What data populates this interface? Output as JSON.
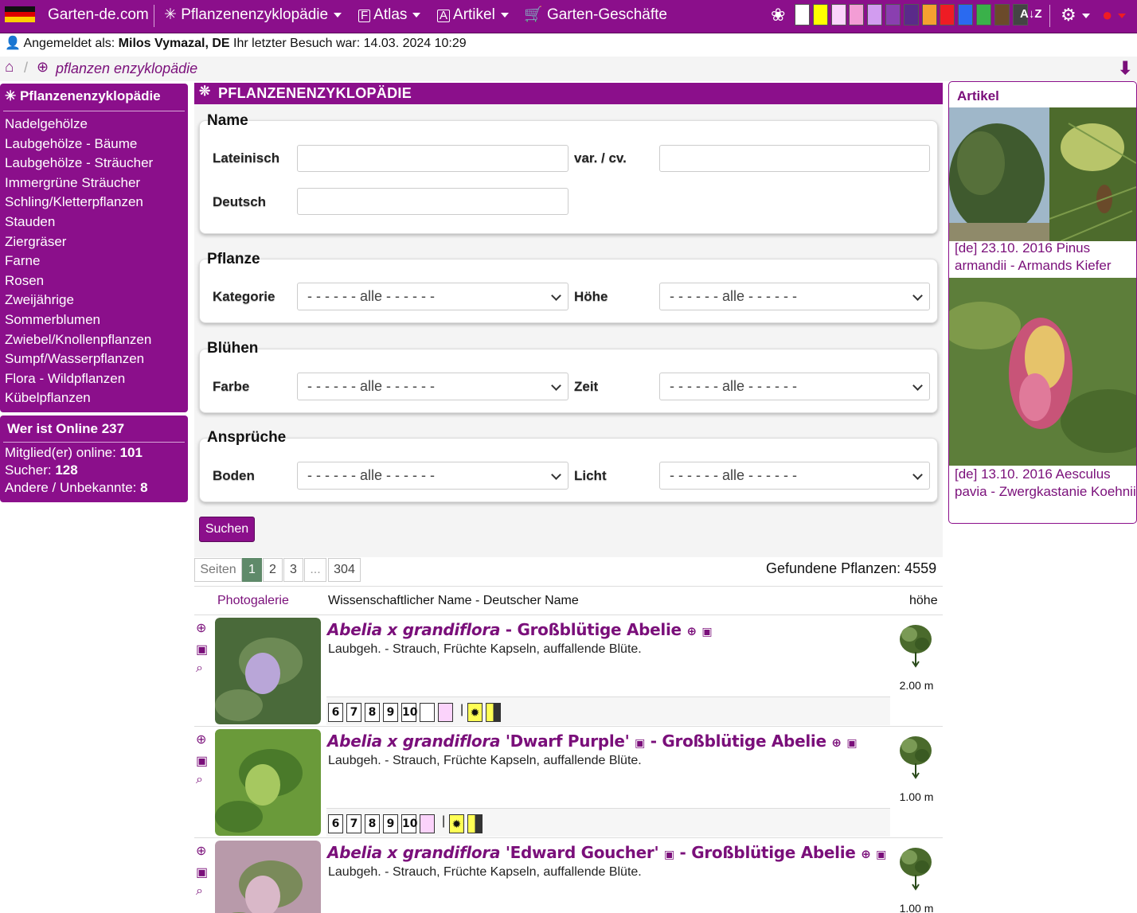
{
  "nav": {
    "site": "Garten-de.com",
    "items": [
      "Pflanzenenzyklopädie",
      "Atlas",
      "Artikel",
      "Garten-Geschäfte"
    ],
    "swatches": [
      "#ffffff",
      "#ffff00",
      "#fbd3fb",
      "#f39dd5",
      "#d29cf0",
      "#8a3fb0",
      "#5a2a8a",
      "#f5a030",
      "#ee1c24",
      "#2a6af0",
      "#3ab14a",
      "#6b4a2a",
      "#444444"
    ]
  },
  "info": {
    "prefix": "Angemeldet als:",
    "user": "Milos Vymazal, DE",
    "last": "Ihr letzter Besuch war: 14.03. 2024 10:29"
  },
  "breadcrumb": {
    "page": "pflanzen enzyklopädie"
  },
  "sidebar": {
    "title": "Pflanzenenzyklopädie",
    "items": [
      "Nadelgehölze",
      "Laubgehölze - Bäume",
      "Laubgehölze - Sträucher",
      "Immergrüne Sträucher",
      "Schling/Kletterpflanzen",
      "Stauden",
      "Ziergräser",
      "Farne",
      "Rosen",
      "Zweijährige",
      "Sommerblumen",
      "Zwiebel/Knollenpflanzen",
      "Sumpf/Wasserpflanzen",
      "Flora - Wildpflanzen",
      "Kübelpflanzen"
    ]
  },
  "online": {
    "title": "Wer ist Online 237",
    "members_label": "Mitglied(er) online:",
    "members": "101",
    "search_label": "Sucher:",
    "search": "128",
    "other_label": "Andere / Unbekannte:",
    "other": "8"
  },
  "main": {
    "title": "PFLANZENENZYKLOPÄDIE",
    "name_legend": "Name",
    "latin": "Lateinisch",
    "var": "var. / cv.",
    "german": "Deutsch",
    "plant_legend": "Pflanze",
    "category": "Kategorie",
    "height": "Höhe",
    "bloom_legend": "Blühen",
    "color": "Farbe",
    "time": "Zeit",
    "req_legend": "Ansprüche",
    "soil": "Boden",
    "light": "Licht",
    "all_option": "- - - - - - alle - - - - - -",
    "search_btn": "Suchen"
  },
  "pagination": {
    "label": "Seiten",
    "pages": [
      "1",
      "2",
      "3",
      "...",
      "304"
    ],
    "found": "Gefundene Pflanzen: 4559"
  },
  "table": {
    "col1": "Photogalerie",
    "col2": "Wissenschaftlicher Name - Deutscher Name",
    "col3": "höhe"
  },
  "rows": [
    {
      "latin": "Abelia x grandiflora",
      "cv": "",
      "german": "Großblütige Abelie",
      "desc": "Laubgeh. - Strauch, Früchte Kapseln, auffallende Blüte.",
      "height": "2.00 m",
      "months": [
        "6",
        "7",
        "8",
        "9",
        "10"
      ]
    },
    {
      "latin": "Abelia x grandiflora",
      "cv": "'Dwarf Purple'",
      "german": "Großblütige Abelie",
      "desc": "Laubgeh. - Strauch, Früchte Kapseln, auffallende Blüte.",
      "height": "1.00 m",
      "months": [
        "6",
        "7",
        "8",
        "9",
        "10"
      ]
    },
    {
      "latin": "Abelia x grandiflora",
      "cv": "'Edward Goucher'",
      "german": "Großblütige Abelie",
      "desc": "Laubgeh. - Strauch, Früchte Kapseln, auffallende Blüte.",
      "height": "1.00 m",
      "months": []
    }
  ],
  "articles": {
    "title": "Artikel",
    "items": [
      {
        "caption": "[de] 23.10. 2016 Pinus armandii - Armands Kiefer"
      },
      {
        "caption": "[de] 13.10. 2016 Aesculus pavia - Zwergkastanie Koehnii"
      }
    ]
  }
}
